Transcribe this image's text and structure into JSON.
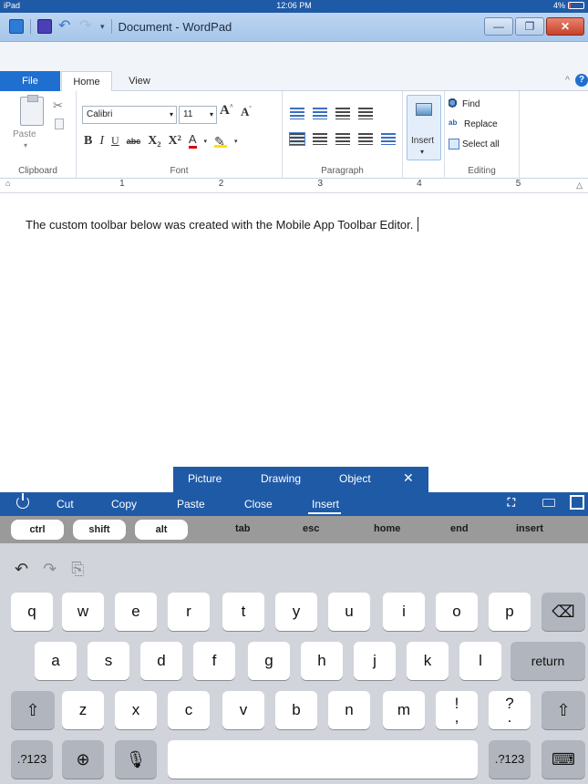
{
  "status": {
    "device": "iPad",
    "time": "12:06 PM",
    "battery": "4%"
  },
  "titlebar": {
    "title": "Document - WordPad",
    "minimize": "—",
    "maximize": "❐",
    "close": "✕"
  },
  "ribbon": {
    "tabs": [
      "File",
      "Home",
      "View"
    ],
    "groups": {
      "clipboard": "Clipboard",
      "font": "Font",
      "paragraph": "Paragraph",
      "editing": "Editing"
    },
    "paste_label": "Paste",
    "font_name": "Calibri",
    "font_size": "11",
    "insert_label": "Insert",
    "find_label": "Find",
    "replace_label": "Replace",
    "select_all_label": "Select all",
    "format_buttons": {
      "bold": "B",
      "italic": "I",
      "underline": "U",
      "strike": "abc",
      "subscript": "X₂",
      "superscript": "X²",
      "color": "A"
    }
  },
  "ruler": {
    "numbers": [
      "1",
      "2",
      "3",
      "4",
      "5"
    ]
  },
  "document": {
    "text": "The custom toolbar below was created with the Mobile App Toolbar Editor."
  },
  "insert_popup": {
    "items": [
      "Picture",
      "Drawing",
      "Object"
    ],
    "close": "✕"
  },
  "mobile_toolbar": {
    "items": [
      "Cut",
      "Copy",
      "Paste",
      "Close",
      "Insert"
    ]
  },
  "modifier_row": {
    "mods": [
      "ctrl",
      "shift",
      "alt"
    ],
    "keys": [
      "tab",
      "esc",
      "home",
      "end",
      "insert"
    ]
  },
  "keyboard": {
    "row1": [
      "q",
      "w",
      "e",
      "r",
      "t",
      "y",
      "u",
      "i",
      "o",
      "p"
    ],
    "row2": [
      "a",
      "s",
      "d",
      "f",
      "g",
      "h",
      "j",
      "k",
      "l"
    ],
    "row3": [
      "z",
      "x",
      "c",
      "v",
      "b",
      "n",
      "m"
    ],
    "return_label": "return",
    "numbers_label": ".?123",
    "punct1_top": "!",
    "punct1_bottom": ",",
    "punct2_top": "?",
    "punct2_bottom": "."
  }
}
